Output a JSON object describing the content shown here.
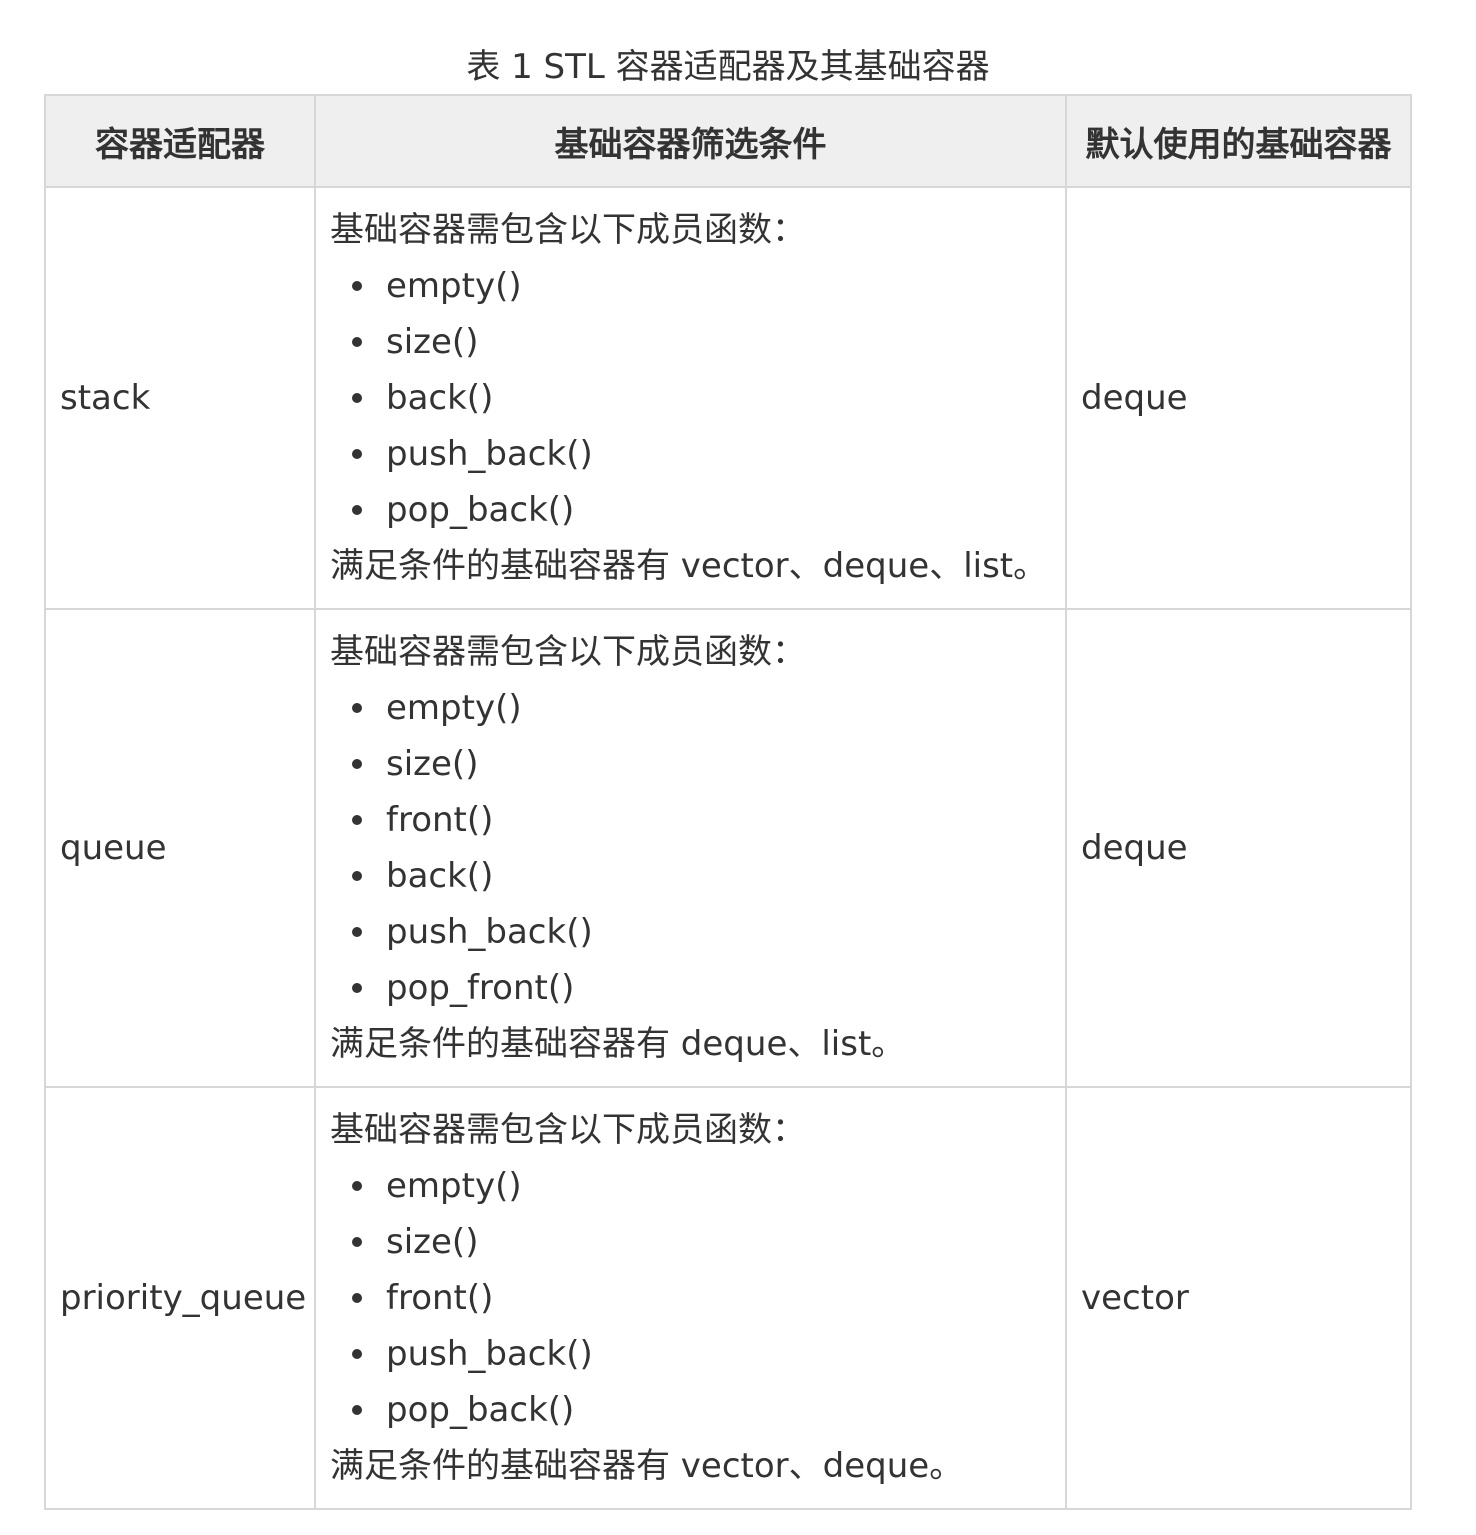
{
  "caption": "表 1 STL 容器适配器及其基础容器",
  "headers": {
    "adapter": "容器适配器",
    "condition": "基础容器筛选条件",
    "default": "默认使用的基础容器"
  },
  "rows": [
    {
      "adapter": "stack",
      "intro": "基础容器需包含以下成员函数：",
      "functions": [
        "empty()",
        "size()",
        "back()",
        "push_back()",
        "pop_back()"
      ],
      "satisfy": "满足条件的基础容器有 vector、deque、list。",
      "default": "deque"
    },
    {
      "adapter": "queue",
      "intro": "基础容器需包含以下成员函数：",
      "functions": [
        "empty()",
        "size()",
        "front()",
        "back()",
        "push_back()",
        "pop_front()"
      ],
      "satisfy": "满足条件的基础容器有 deque、list。",
      "default": "deque"
    },
    {
      "adapter": "priority_queue",
      "intro": "基础容器需包含以下成员函数：",
      "functions": [
        "empty()",
        "size()",
        "front()",
        "push_back()",
        "pop_back()"
      ],
      "satisfy": "满足条件的基础容器有 vector、deque。",
      "default": "vector"
    }
  ]
}
